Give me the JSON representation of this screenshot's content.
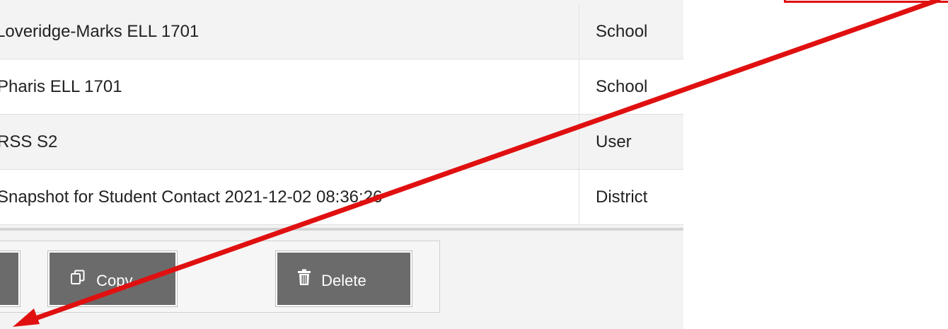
{
  "table": {
    "rows": [
      {
        "name": "Loveridge-Marks ELL 1701",
        "type": "School"
      },
      {
        "name": "Pharis ELL 1701",
        "type": "School"
      },
      {
        "name": "RSS S2",
        "type": "User"
      },
      {
        "name": "Snapshot for Student Contact 2021-12-02 08:36:26",
        "type": "District"
      }
    ]
  },
  "toolbar": {
    "copy_label": "Copy",
    "delete_label": "Delete"
  },
  "icons": {
    "copy": "copy-icon",
    "delete": "trash-icon"
  },
  "colors": {
    "button_bg": "#6b6b6b",
    "annotation_red": "#e01010",
    "row_alt": "#f3f3f3"
  }
}
